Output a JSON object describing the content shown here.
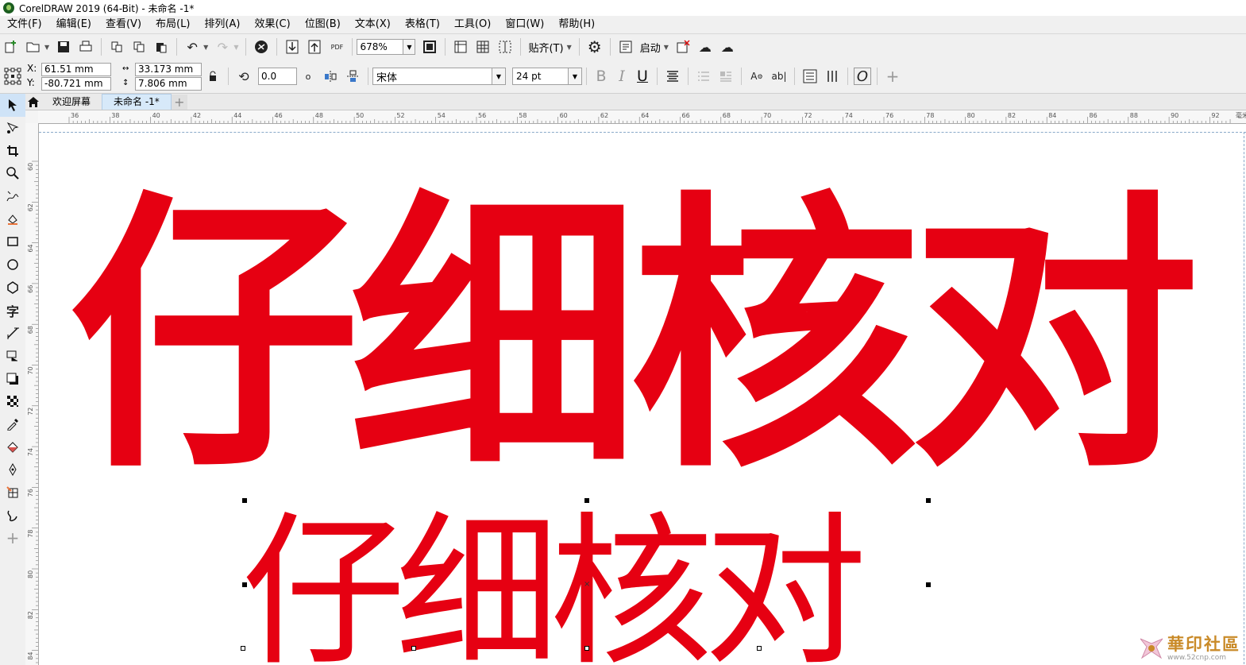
{
  "window": {
    "title": "CorelDRAW 2019 (64-Bit) - 未命名 -1*"
  },
  "menu": [
    "文件(F)",
    "编辑(E)",
    "查看(V)",
    "布局(L)",
    "排列(A)",
    "效果(C)",
    "位图(B)",
    "文本(X)",
    "表格(T)",
    "工具(O)",
    "窗口(W)",
    "帮助(H)"
  ],
  "toolbar": {
    "zoom": "678%",
    "snap_label": "贴齐(T)",
    "launch_label": "启动",
    "pdf_label": "PDF"
  },
  "property_bar": {
    "x_label": "X:",
    "y_label": "Y:",
    "x_value": "61.51 mm",
    "y_value": "-80.721 mm",
    "width_value": "33.173 mm",
    "height_value": "7.806 mm",
    "angle_value": "0.0",
    "degree_symbol": "o",
    "font_name": "宋体",
    "font_size": "24 pt",
    "bold": "B",
    "italic": "I",
    "underline": "U",
    "plus": "+"
  },
  "tabs": {
    "welcome": "欢迎屏幕",
    "document": "未命名 -1*",
    "add": "+"
  },
  "rulers": {
    "horizontal": [
      "36",
      "38",
      "40",
      "42",
      "44",
      "46",
      "48",
      "50",
      "52",
      "54",
      "56",
      "58",
      "60",
      "62",
      "64",
      "66",
      "68",
      "70",
      "72",
      "74",
      "76",
      "78",
      "80",
      "82",
      "84",
      "86",
      "88",
      "90",
      "92"
    ],
    "horizontal_unit": "毫米",
    "vertical": [
      "60",
      "62",
      "64",
      "66",
      "68",
      "70",
      "72",
      "74",
      "76",
      "78",
      "80",
      "82",
      "84"
    ]
  },
  "canvas": {
    "big_text": "仔细核对",
    "small_text": "仔细核对",
    "text_color": "#e60012"
  },
  "watermark": {
    "text": "華印社區",
    "url": "www.52cnp.com"
  },
  "icons": {
    "toolbox": [
      "pick-tool-icon",
      "shape-tool-icon",
      "crop-tool-icon",
      "zoom-tool-icon",
      "freehand-tool-icon",
      "smart-fill-icon",
      "rectangle-tool-icon",
      "ellipse-tool-icon",
      "polygon-tool-icon",
      "text-tool-icon",
      "parallel-dimension-icon",
      "connector-tool-icon",
      "drop-shadow-icon",
      "transparency-tool-icon",
      "eyedropper-icon",
      "interactive-fill-icon",
      "smart-drawing-icon",
      "mesh-fill-icon",
      "smear-tool-icon",
      "add-tool-icon"
    ]
  },
  "toolbox_text_glyph": "字"
}
